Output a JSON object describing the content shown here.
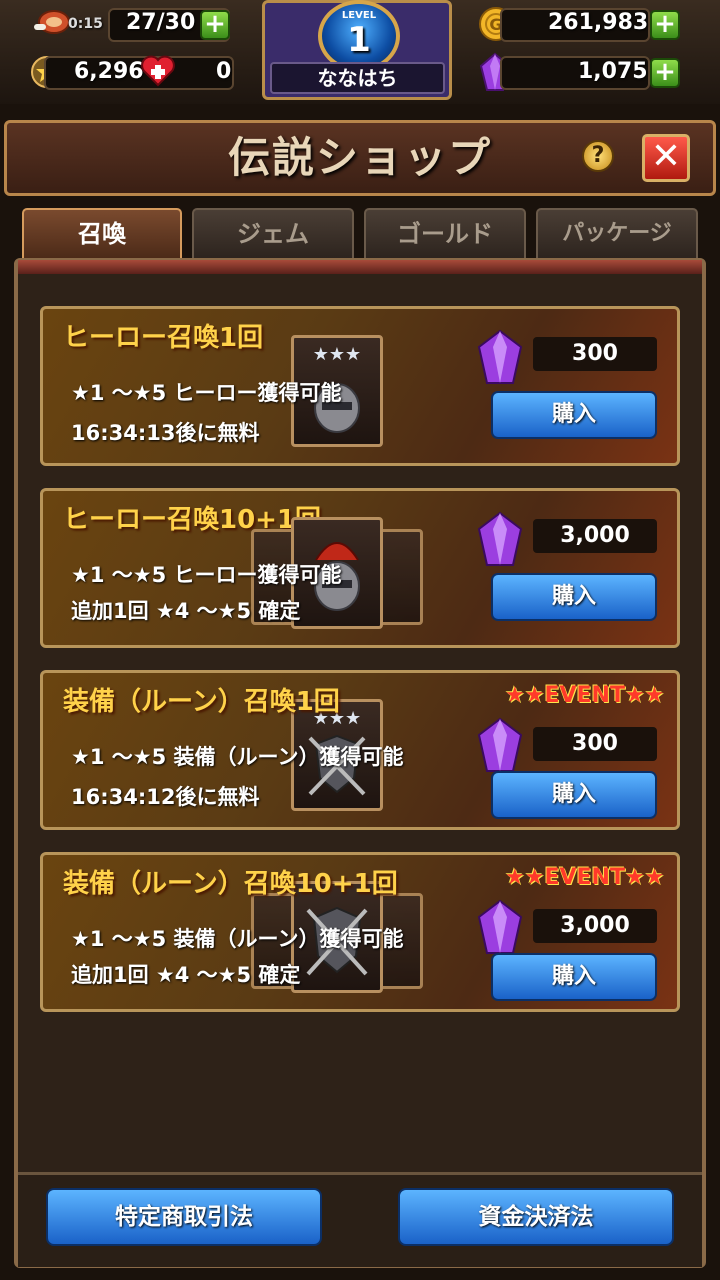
{
  "topbar": {
    "stamina_timer": "0:15",
    "stamina": "27/30",
    "honor": "6,296",
    "hearts": "0",
    "gold": "261,983",
    "gems": "1,075",
    "level_label": "LEVEL",
    "level": "1",
    "player_name": "ななはち"
  },
  "title": "伝説ショップ",
  "help_label": "?",
  "close_label": "✕",
  "tabs": [
    {
      "label": "召喚",
      "active": true
    },
    {
      "label": "ジェム",
      "active": false
    },
    {
      "label": "ゴールド",
      "active": false
    },
    {
      "label": "パッケージ",
      "active": false
    }
  ],
  "items": [
    {
      "title": "ヒーロー召喚1回",
      "line1": "★1 ～★5 ヒーロー獲得可能",
      "line2": "16:34:13後に無料",
      "price": "300",
      "buy_label": "購入",
      "event": ""
    },
    {
      "title": "ヒーロー召喚10+1回",
      "line1": "★1 ～★5 ヒーロー獲得可能",
      "line2": "追加1回 ★4 ～★5 確定",
      "price": "3,000",
      "buy_label": "購入",
      "event": ""
    },
    {
      "title": "装備（ルーン）召喚1回",
      "line1": "★1 ～★5 装備（ルーン）獲得可能",
      "line2": "16:34:12後に無料",
      "price": "300",
      "buy_label": "購入",
      "event": "★★EVENT★★"
    },
    {
      "title": "装備（ルーン）召喚10+1回",
      "line1": "★1 ～★5 装備（ルーン）獲得可能",
      "line2": "追加1回 ★4 ～★5 確定",
      "price": "3,000",
      "buy_label": "購入",
      "event": "★★EVENT★★"
    }
  ],
  "footer": {
    "left_button": "特定商取引法",
    "right_button": "資金決済法"
  },
  "colors": {
    "accent_gold": "#ffd24a",
    "button_blue": "#1a62c8",
    "gem_purple": "#9b3ee0",
    "plus_green": "#5fbf2a"
  }
}
